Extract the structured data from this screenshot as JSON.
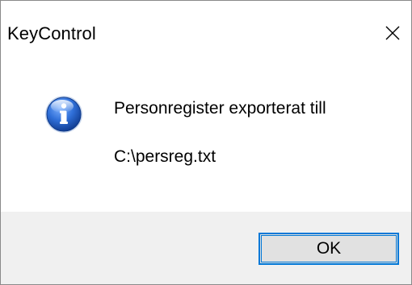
{
  "window": {
    "title": "KeyControl",
    "close_icon": "close-icon"
  },
  "message": {
    "icon": "info-icon",
    "line1": "Personregister exporterat till",
    "line2": "C:\\persreg.txt"
  },
  "buttons": {
    "ok_label": "OK"
  },
  "colors": {
    "accent": "#0078d7",
    "footer_bg": "#f0f0f0",
    "button_bg": "#e1e1e1"
  }
}
